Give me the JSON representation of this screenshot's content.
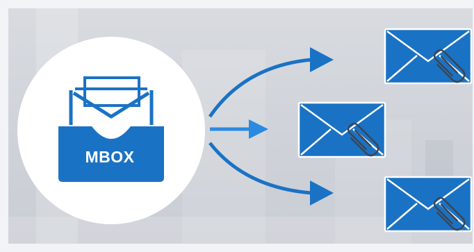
{
  "source": {
    "label": "MBOX",
    "icon": "mbox-inbox-icon"
  },
  "outputs": [
    {
      "icon": "envelope-attachment-icon"
    },
    {
      "icon": "envelope-attachment-icon"
    },
    {
      "icon": "envelope-attachment-icon"
    }
  ],
  "colors": {
    "accent": "#1a72c4",
    "accent_light": "#2a8ae0",
    "circle": "#ffffff",
    "background": "#d3d6dc"
  }
}
